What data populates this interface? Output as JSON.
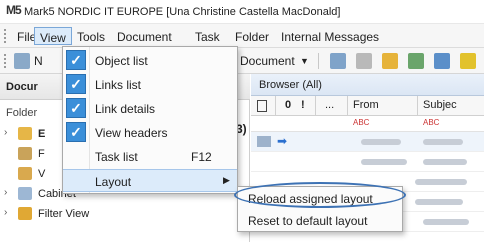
{
  "window": {
    "logo": "M5",
    "title": "Mark5 NORDIC IT EUROPE [Una Christine Castella MacDonald]"
  },
  "menubar": {
    "items": [
      "File",
      "View",
      "Tools",
      "Document",
      "Task",
      "Folder",
      "Internal Messages"
    ],
    "active": "View"
  },
  "toolbar": {
    "n_fragment": "N",
    "document_label": "Document"
  },
  "left_pane": {
    "header": "Docur",
    "folder_label": "Folder",
    "tree_bold_suffix": "3)",
    "tree": [
      {
        "label": "E",
        "icon": "folder-icon"
      },
      {
        "label": "F",
        "icon": "document-icon"
      },
      {
        "label": "V",
        "icon": "folder-icon"
      },
      {
        "label": "Cabinet",
        "icon": "cabinet-icon"
      },
      {
        "label": "Filter View",
        "icon": "filter-folder-icon"
      }
    ]
  },
  "browser": {
    "tab_label": "Browser (All)",
    "columns": [
      "...",
      "From",
      "Subjec"
    ],
    "filter_glyph": "ABC"
  },
  "view_menu": {
    "items": [
      {
        "label": "Object list",
        "checked": true,
        "shortcut": ""
      },
      {
        "label": "Links list",
        "checked": true,
        "shortcut": ""
      },
      {
        "label": "Link details",
        "checked": true,
        "shortcut": ""
      },
      {
        "label": "View headers",
        "checked": true,
        "shortcut": ""
      },
      {
        "label": "Task list",
        "checked": false,
        "shortcut": "F12"
      },
      {
        "label": "Layout",
        "checked": false,
        "shortcut": "",
        "submenu": true
      }
    ]
  },
  "layout_submenu": {
    "items": [
      "Reload assigned layout",
      "Reset to default layout"
    ]
  },
  "colors": {
    "accent": "#3b8fd9",
    "highlight": "#dcebfa",
    "callout": "#3d72b4"
  }
}
